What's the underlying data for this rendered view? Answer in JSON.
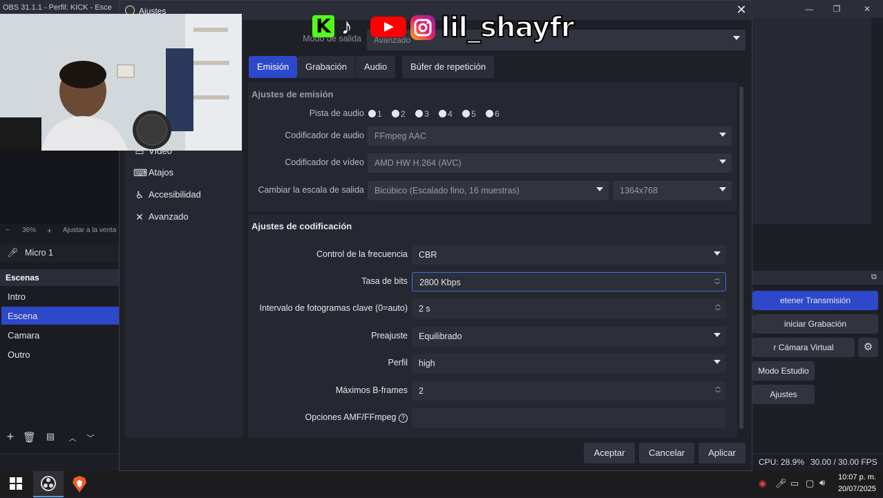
{
  "main_window": {
    "title": "OBS 31.1.1 - Perfil: KICK - Esce",
    "min": "—",
    "max": "❐",
    "close": "✕"
  },
  "left": {
    "zoom": "36%",
    "zoom_fit": "Ajustar a la venta",
    "zoom_minus": "−",
    "zoom_plus": "+",
    "mixer_label": "Micro 1",
    "scenes_header": "Escenas",
    "scenes": [
      "Intro",
      "Escena",
      "Camara",
      "Outro"
    ],
    "selected_scene": "Escena"
  },
  "dialog": {
    "title": "Ajustes",
    "close": "✕",
    "sidebar": [
      {
        "label": "Vídeo",
        "icon": "monitor-icon"
      },
      {
        "label": "Atajos",
        "icon": "keyboard-icon"
      },
      {
        "label": "Accesibilidad",
        "icon": "accessibility-icon"
      },
      {
        "label": "Avanzado",
        "icon": "wrench-icon"
      }
    ],
    "output_mode_label": "Modo de salida",
    "output_mode_value": "Avanzado",
    "tabs": [
      "Emisión",
      "Grabación",
      "Audio",
      "Búfer de repetición"
    ],
    "active_tab": "Emisión",
    "stream_settings": {
      "title": "Ajustes de emisión",
      "audio_track_label": "Pista de audio",
      "tracks": [
        "1",
        "2",
        "3",
        "4",
        "5",
        "6"
      ],
      "audio_encoder_label": "Codificador de audio",
      "audio_encoder": "FFmpeg AAC",
      "video_encoder_label": "Codificador de vídeo",
      "video_encoder": "AMD HW H.264 (AVC)",
      "rescale_label": "Cambiar la escala de salida",
      "rescale_filter": "Bicúbico (Escalado fino, 16 muestras)",
      "rescale_resolution": "1364x768"
    },
    "encoder_settings": {
      "title": "Ajustes de codificación",
      "rate_control_label": "Control de la frecuencia",
      "rate_control": "CBR",
      "bitrate_label": "Tasa de bits",
      "bitrate": "2800 Kbps",
      "keyframe_label": "Intervalo de fotogramas clave (0=auto)",
      "keyframe": "2 s",
      "preset_label": "Preajuste",
      "preset": "Equilibrado",
      "profile_label": "Perfil",
      "profile": "high",
      "bframes_label": "Máximos B-frames",
      "bframes": "2",
      "amf_label": "Opciones AMF/FFmpeg",
      "amf_value": ""
    },
    "buttons": {
      "accept": "Aceptar",
      "cancel": "Cancelar",
      "apply": "Aplicar"
    }
  },
  "controls": {
    "stop_stream": "etener Transmisión",
    "start_recording": "iniciar Grabación",
    "virtual_cam": "r Cámara Virtual",
    "studio_mode": "Modo Estudio",
    "settings": "Ajustes"
  },
  "status": {
    "cpu": "CPU: 28.9%",
    "fps": "30.00 / 30.00 FPS"
  },
  "overlay": {
    "username": "lil_shayfr"
  },
  "taskbar": {
    "time": "10:07 p. m.",
    "date": "20/07/2025"
  },
  "colors": {
    "accent": "#2d48c9",
    "bg": "#1e1f26",
    "panel": "#262831"
  }
}
